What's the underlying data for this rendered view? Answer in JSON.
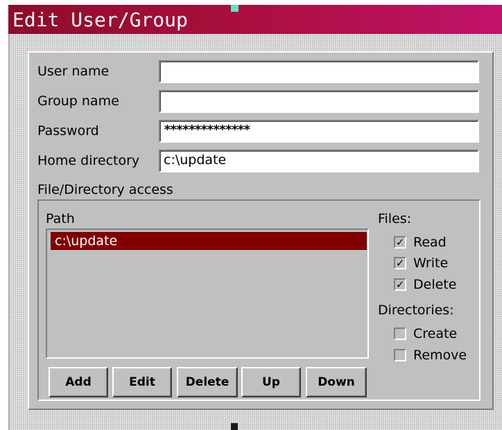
{
  "window": {
    "title": "Edit User/Group"
  },
  "form": {
    "user_name_label": "User name",
    "user_name_value": "",
    "group_name_label": "Group name",
    "group_name_value": "",
    "password_label": "Password",
    "password_value": "**************",
    "home_directory_label": "Home directory",
    "home_directory_value": "c:\\update"
  },
  "access": {
    "section_label": "File/Directory access",
    "path_header": "Path",
    "paths": [
      {
        "value": "c:\\update",
        "selected": true
      }
    ],
    "buttons": {
      "add": "Add",
      "edit": "Edit",
      "delete": "Delete",
      "up": "Up",
      "down": "Down"
    },
    "files_label": "Files:",
    "files": [
      {
        "label": "Read",
        "checked": true
      },
      {
        "label": "Write",
        "checked": true
      },
      {
        "label": "Delete",
        "checked": true
      }
    ],
    "directories_label": "Directories:",
    "directories": [
      {
        "label": "Create",
        "checked": false
      },
      {
        "label": "Remove",
        "checked": false
      }
    ]
  },
  "theme": {
    "titlebar_start": "#8e0c2b",
    "titlebar_end": "#c2126a",
    "selection": "#800000",
    "face": "#c0c0c0"
  }
}
